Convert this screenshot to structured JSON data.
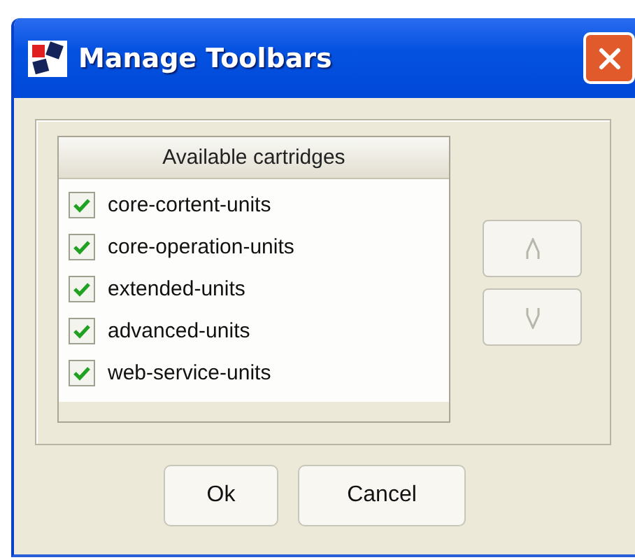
{
  "window": {
    "title": "Manage Toolbars"
  },
  "list": {
    "header": "Available cartridges",
    "items": [
      {
        "label": "core-cortent-units",
        "checked": true
      },
      {
        "label": "core-operation-units",
        "checked": true
      },
      {
        "label": "extended-units",
        "checked": true
      },
      {
        "label": "advanced-units",
        "checked": true
      },
      {
        "label": "web-service-units",
        "checked": true
      }
    ]
  },
  "move_buttons": [
    {
      "kind": "up",
      "disabled": true
    },
    {
      "kind": "down",
      "disabled": true
    }
  ],
  "buttons": [
    "Ok",
    "Cancel"
  ]
}
